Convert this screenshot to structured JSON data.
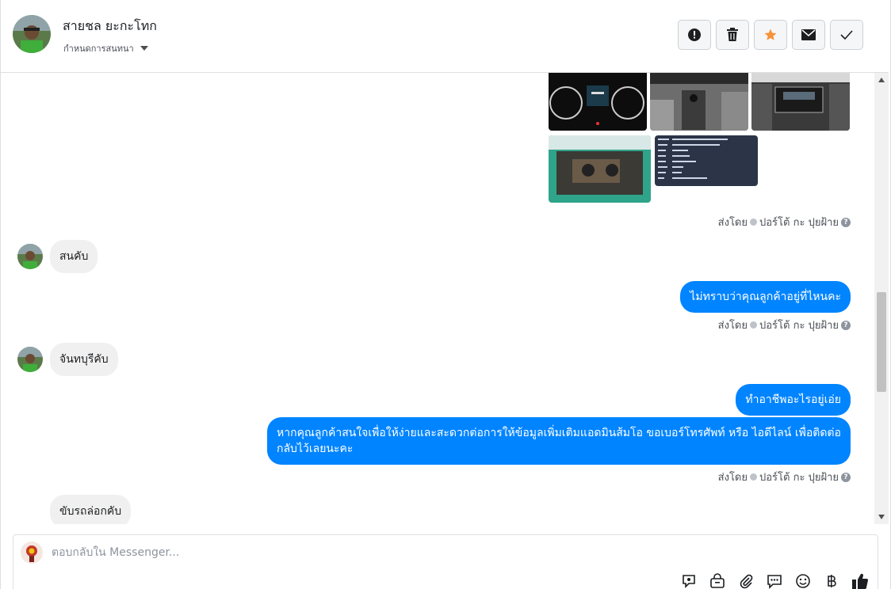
{
  "header": {
    "contact_name": "สายชล ยะกะโทก",
    "conversation_setting": "กำหนดการสนทนา",
    "actions": [
      "alert-icon",
      "trash-icon",
      "star-icon",
      "envelope-icon",
      "check-icon"
    ],
    "star_color": "#f7923b"
  },
  "thread": {
    "sent_by_label": "ส่งโดย",
    "agent_name": "ปอร์โต้ กะ ปุยฝ้าย",
    "messages": [
      {
        "direction": "incoming",
        "text": "สนคับ"
      },
      {
        "direction": "outgoing",
        "text": "ไม่ทราบว่าคุณลูกค้าอยู่ที่ไหนคะ"
      },
      {
        "direction": "incoming",
        "text": "จันทบุรีคับ"
      },
      {
        "direction": "outgoing",
        "text": "ทำอาชีพอะไรอยู่เอ่ย"
      },
      {
        "direction": "outgoing",
        "text": "หากคุณลูกค้าสนใจเพื่อให้ง่ายและสะดวกต่อการให้ข้อมูลเพิ่มเติมแอดมินส้มโอ ขอเบอร์โทรศัพท์ หรือ ไอดีไลน์ เพื่อติดต่อกลับไว้เลยนะคะ"
      },
      {
        "direction": "incoming",
        "text": "ขับรถล่อกคับ"
      }
    ],
    "bubble_color": "#0084ff"
  },
  "composer": {
    "placeholder": "ตอบกลับใน Messenger...",
    "tools": [
      "sticker-icon",
      "shop-icon",
      "attachment-icon",
      "saved-reply-icon",
      "emoji-icon",
      "baht-icon",
      "like-icon"
    ]
  }
}
